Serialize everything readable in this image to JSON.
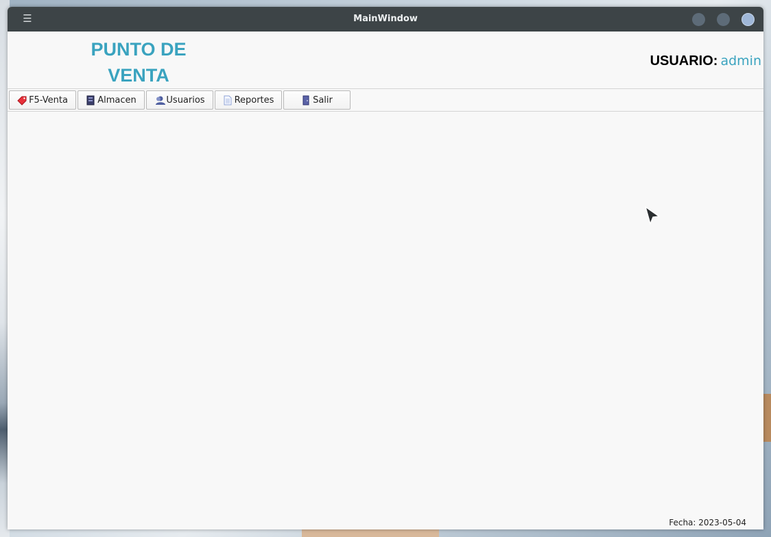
{
  "window": {
    "title": "MainWindow"
  },
  "header": {
    "brand_line1": "PUNTO DE",
    "brand_line2": "VENTA",
    "user_label": "USUARIO:",
    "user_value": "admin"
  },
  "toolbar": {
    "buttons": [
      {
        "label": "F5-Venta",
        "icon": "tag-icon"
      },
      {
        "label": "Almacen",
        "icon": "warehouse-icon"
      },
      {
        "label": "Usuarios",
        "icon": "user-icon"
      },
      {
        "label": "Reportes",
        "icon": "document-icon"
      },
      {
        "label": "Salir",
        "icon": "door-icon"
      }
    ]
  },
  "status": {
    "date_text": "Fecha: 2023-05-04"
  },
  "colors": {
    "accent": "#3aa3bf",
    "titlebar": "#3d4447",
    "background": "#f8f8f8"
  }
}
